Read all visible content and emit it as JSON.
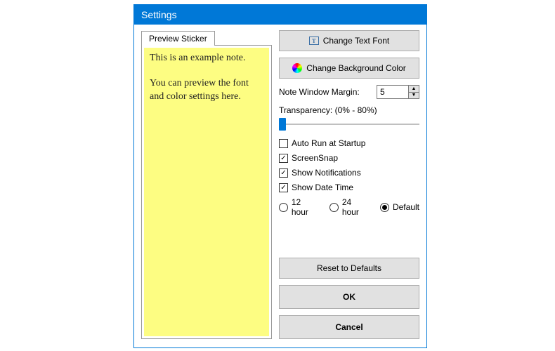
{
  "window": {
    "title": "Settings"
  },
  "preview": {
    "tab_label": "Preview Sticker",
    "note_text": "This is an example note.\n\nYou can preview the font and color settings here."
  },
  "buttons": {
    "change_font": "Change Text Font",
    "change_bg": "Change Background Color",
    "reset": "Reset to Defaults",
    "ok": "OK",
    "cancel": "Cancel"
  },
  "margin": {
    "label": "Note Window Margin:",
    "value": "5"
  },
  "transparency": {
    "label": "Transparency: (0% - 80%)"
  },
  "options": {
    "autorun": {
      "label": "Auto Run at Startup",
      "checked": false
    },
    "screensnap": {
      "label": "ScreenSnap",
      "checked": true
    },
    "notifications": {
      "label": "Show Notifications",
      "checked": true
    },
    "datetime": {
      "label": "Show Date Time",
      "checked": true
    }
  },
  "timefmt": {
    "h12": "12 hour",
    "h24": "24 hour",
    "def": "Default",
    "selected": "def"
  }
}
